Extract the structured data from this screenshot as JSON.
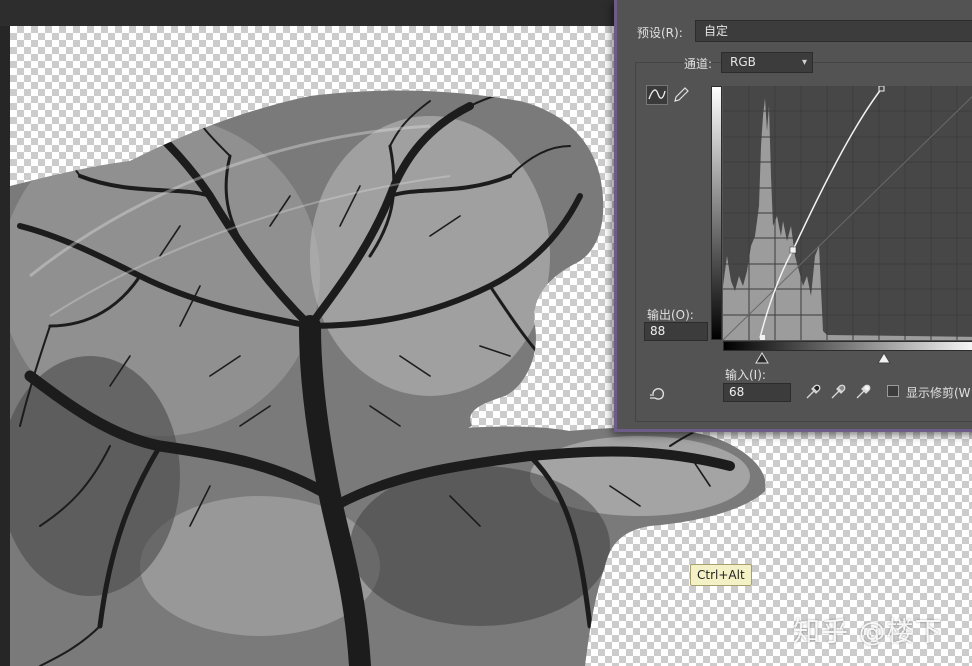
{
  "dialog": {
    "preset_label": "预设(R):",
    "preset_value": "自定",
    "channel_label": "通道:",
    "channel_value": "RGB",
    "output_label": "输出(O):",
    "output_value": "88",
    "input_label": "输入(I):",
    "input_value": "68",
    "show_clipping_label": "显示修剪(W"
  },
  "curve": {
    "input": [
      0,
      68,
      255
    ],
    "output": [
      0,
      88,
      255
    ]
  },
  "tooltip": {
    "text": "Ctrl+Alt"
  },
  "watermark": {
    "text": "知乎 @楼下"
  },
  "icons": [
    "curve-tool-icon",
    "pencil-icon",
    "target-adjust-icon",
    "black-eyedropper-icon",
    "gray-eyedropper-icon",
    "white-eyedropper-icon",
    "chevron-down-icon"
  ],
  "colors": {
    "dialog_bg": "#535353",
    "dialog_accent": "#6d5b88",
    "graph_bg": "#474747",
    "tooltip_bg": "#f5f1c6"
  }
}
